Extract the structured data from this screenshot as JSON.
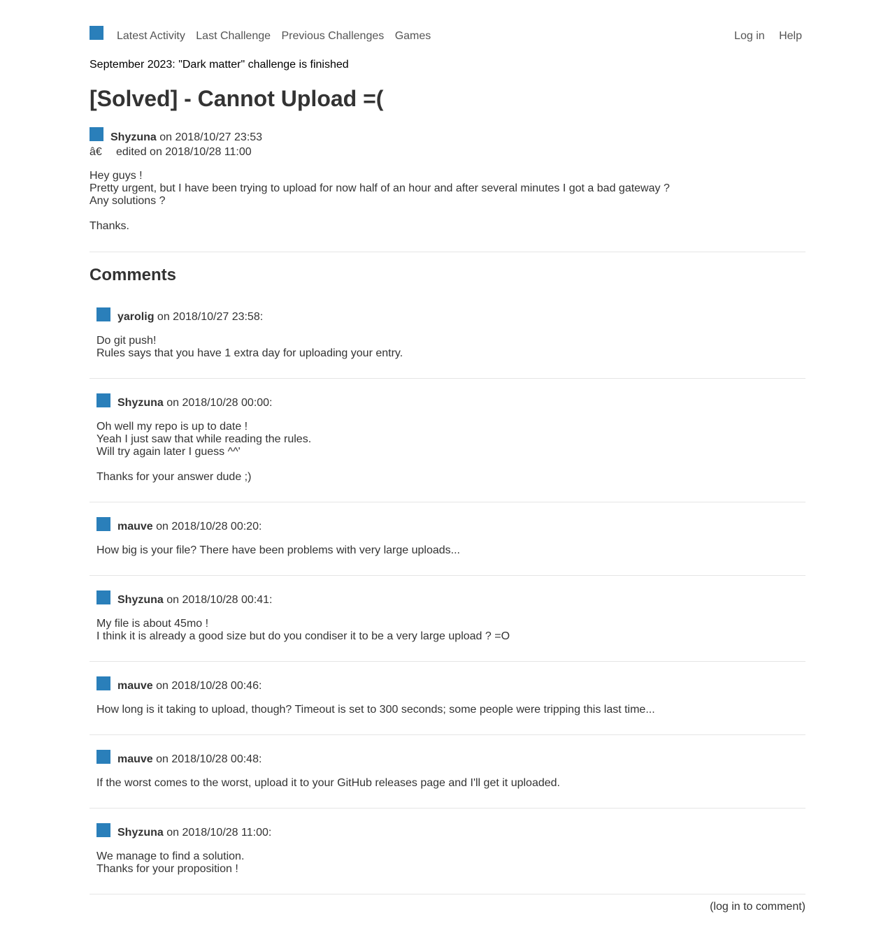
{
  "nav": {
    "left": [
      "Latest Activity",
      "Last Challenge",
      "Previous Challenges",
      "Games"
    ],
    "right": [
      "Log in",
      "Help"
    ]
  },
  "announcement": "September 2023: \"Dark matter\" challenge is finished",
  "post": {
    "title": "[Solved] - Cannot Upload =(",
    "author": "Shyzuna",
    "date_text": "on 2018/10/27 23:53",
    "edit_icon_text": "â€",
    "edited_text": "edited on 2018/10/28 11:00",
    "body": [
      "Hey guys !",
      "Pretty urgent, but I have been trying to upload for now half of an hour and after several minutes I got a bad gateway ?",
      "Any solutions ?",
      "",
      "Thanks."
    ]
  },
  "comments_title": "Comments",
  "comments": [
    {
      "author": "yarolig",
      "date_text": "on 2018/10/27 23:58:",
      "body": [
        "Do git push!",
        "Rules says that you have 1 extra day for uploading your entry."
      ]
    },
    {
      "author": "Shyzuna",
      "date_text": "on 2018/10/28 00:00:",
      "body": [
        "Oh well my repo is up to date !",
        "Yeah I just saw that while reading the rules.",
        "Will try again later I guess ^^'",
        "",
        "Thanks for your answer dude ;)"
      ]
    },
    {
      "author": "mauve",
      "date_text": "on 2018/10/28 00:20:",
      "body": [
        "How big is your file? There have been problems with very large uploads..."
      ]
    },
    {
      "author": "Shyzuna",
      "date_text": "on 2018/10/28 00:41:",
      "body": [
        "My file is about 45mo !",
        "I think it is already a good size but do you condiser it to be a very large upload ? =O"
      ]
    },
    {
      "author": "mauve",
      "date_text": "on 2018/10/28 00:46:",
      "body": [
        "How long is it taking to upload, though? Timeout is set to 300 seconds; some people were tripping this last time..."
      ]
    },
    {
      "author": "mauve",
      "date_text": "on 2018/10/28 00:48:",
      "body": [
        "If the worst comes to the worst, upload it to your GitHub releases page and I'll get it uploaded."
      ]
    },
    {
      "author": "Shyzuna",
      "date_text": "on 2018/10/28 11:00:",
      "body": [
        "We manage to find a solution.",
        "Thanks for your proposition !"
      ]
    }
  ],
  "login_to_comment": "(log in to comment)",
  "colors": {
    "avatar": "#2a7fba",
    "text": "#333333",
    "nav_link": "#555555"
  }
}
